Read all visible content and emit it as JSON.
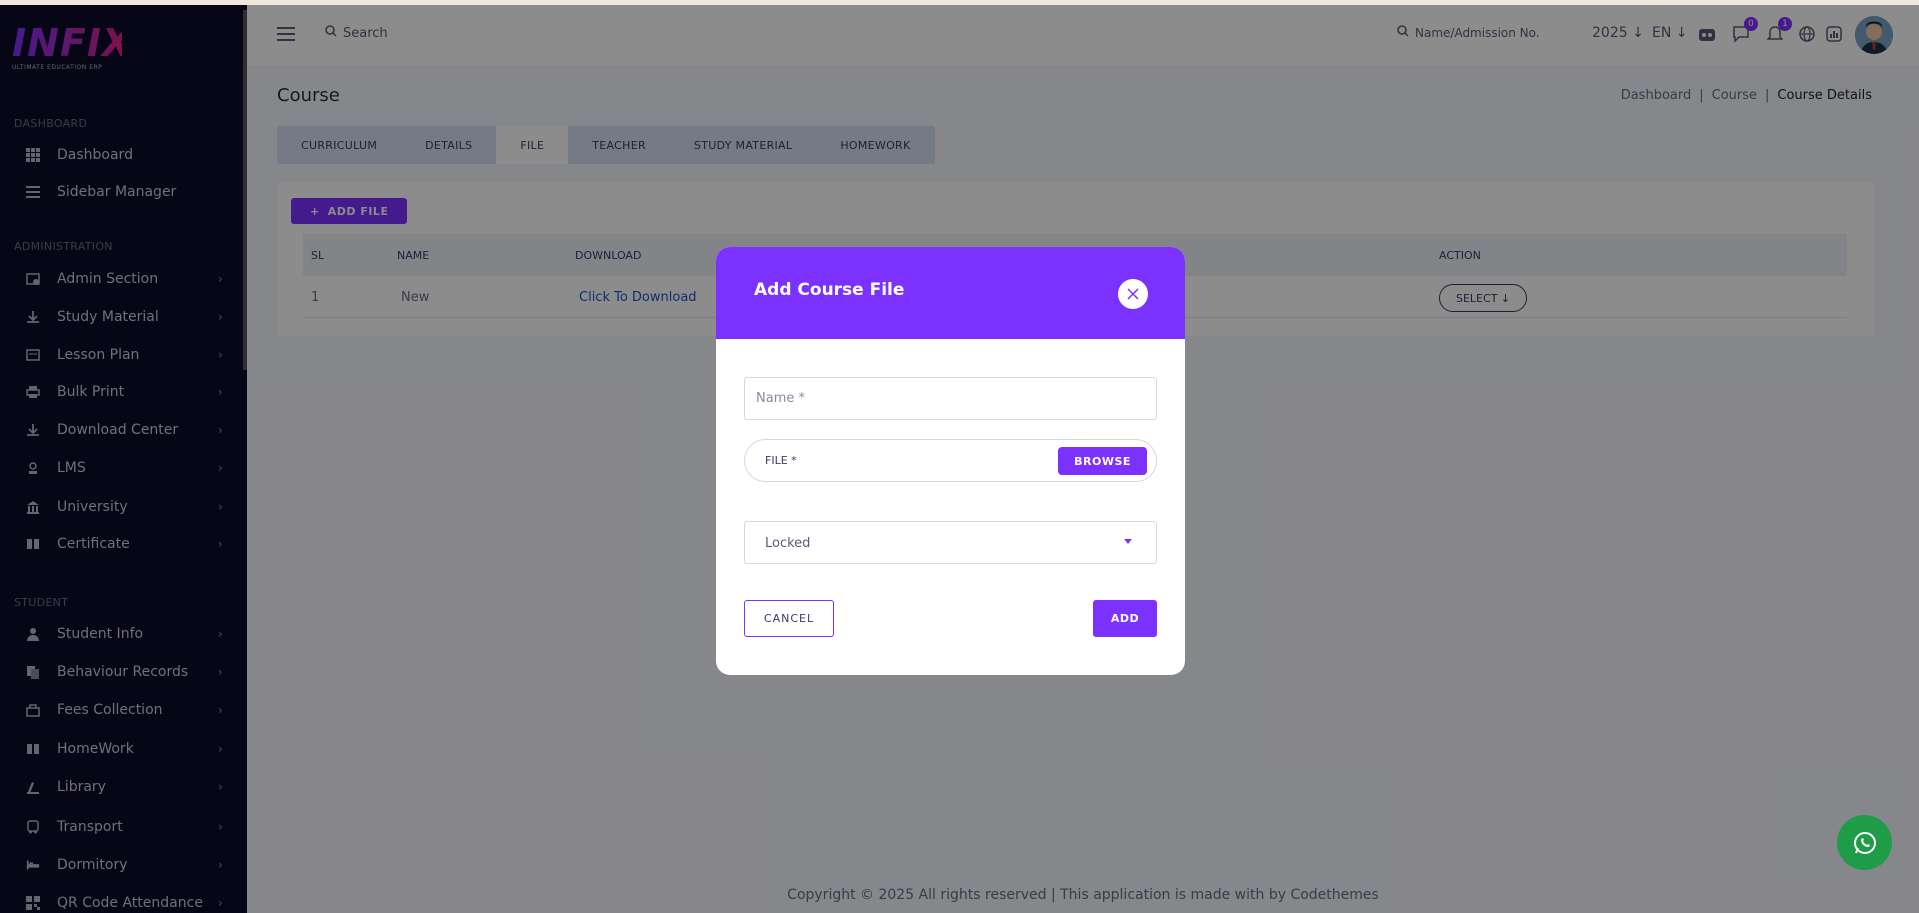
{
  "app": {
    "logo_text": "INFIX",
    "logo_sub": "ULTIMATE EDUCATION ERP"
  },
  "sidebar": {
    "sections": [
      "DASHBOARD",
      "ADMINISTRATION",
      "STUDENT"
    ],
    "items": [
      {
        "label": "Dashboard",
        "icon": "grid-icon",
        "chevron": false
      },
      {
        "label": "Sidebar Manager",
        "icon": "list-icon",
        "chevron": false
      },
      {
        "label": "Admin Section",
        "icon": "admin-icon",
        "chevron": true
      },
      {
        "label": "Study Material",
        "icon": "download-icon",
        "chevron": true
      },
      {
        "label": "Lesson Plan",
        "icon": "lesson-icon",
        "chevron": true
      },
      {
        "label": "Bulk Print",
        "icon": "print-icon",
        "chevron": true
      },
      {
        "label": "Download Center",
        "icon": "download-icon",
        "chevron": true
      },
      {
        "label": "LMS",
        "icon": "lms-icon",
        "chevron": true
      },
      {
        "label": "University",
        "icon": "university-icon",
        "chevron": true
      },
      {
        "label": "Certificate",
        "icon": "certificate-icon",
        "chevron": true
      },
      {
        "label": "Student Info",
        "icon": "user-icon",
        "chevron": true
      },
      {
        "label": "Behaviour Records",
        "icon": "records-icon",
        "chevron": true
      },
      {
        "label": "Fees Collection",
        "icon": "fees-icon",
        "chevron": true
      },
      {
        "label": "HomeWork",
        "icon": "book-icon",
        "chevron": true
      },
      {
        "label": "Library",
        "icon": "library-icon",
        "chevron": true
      },
      {
        "label": "Transport",
        "icon": "bus-icon",
        "chevron": true
      },
      {
        "label": "Dormitory",
        "icon": "bed-icon",
        "chevron": true
      },
      {
        "label": "QR Code Attendance",
        "icon": "qr-icon",
        "chevron": true
      }
    ]
  },
  "header": {
    "search_label": "Search",
    "student_search_label": "Name/Admission No.",
    "year": "2025",
    "lang": "EN",
    "chat_badge": "0",
    "notif_badge": "1"
  },
  "main": {
    "title": "Course",
    "breadcrumb": [
      "Dashboard",
      "|",
      "Course",
      "|",
      "Course Details"
    ],
    "tabs": [
      "CURRICULUM",
      "DETAILS",
      "FILE",
      "TEACHER",
      "STUDY MATERIAL",
      "HOMEWORK"
    ],
    "active_tab": "FILE",
    "add_file_label": "ADD FILE",
    "table": {
      "columns": [
        "SL",
        "NAME",
        "DOWNLOAD",
        "ACTION"
      ],
      "rows": [
        {
          "sl": "1",
          "name": "New",
          "download": "Click To Download",
          "action": "SELECT"
        }
      ]
    },
    "footer": "Copyright © 2025 All rights reserved | This application is made with by Codethemes"
  },
  "modal": {
    "title": "Add Course File",
    "name_placeholder": "Name *",
    "file_label": "FILE *",
    "browse_label": "BROWSE",
    "select_value": "Locked",
    "cancel_label": "CANCEL",
    "add_label": "ADD"
  },
  "colors": {
    "accent": "#7c32ff",
    "sidebar_bg": "#0b0b2a",
    "whatsapp": "#1f9c47"
  }
}
